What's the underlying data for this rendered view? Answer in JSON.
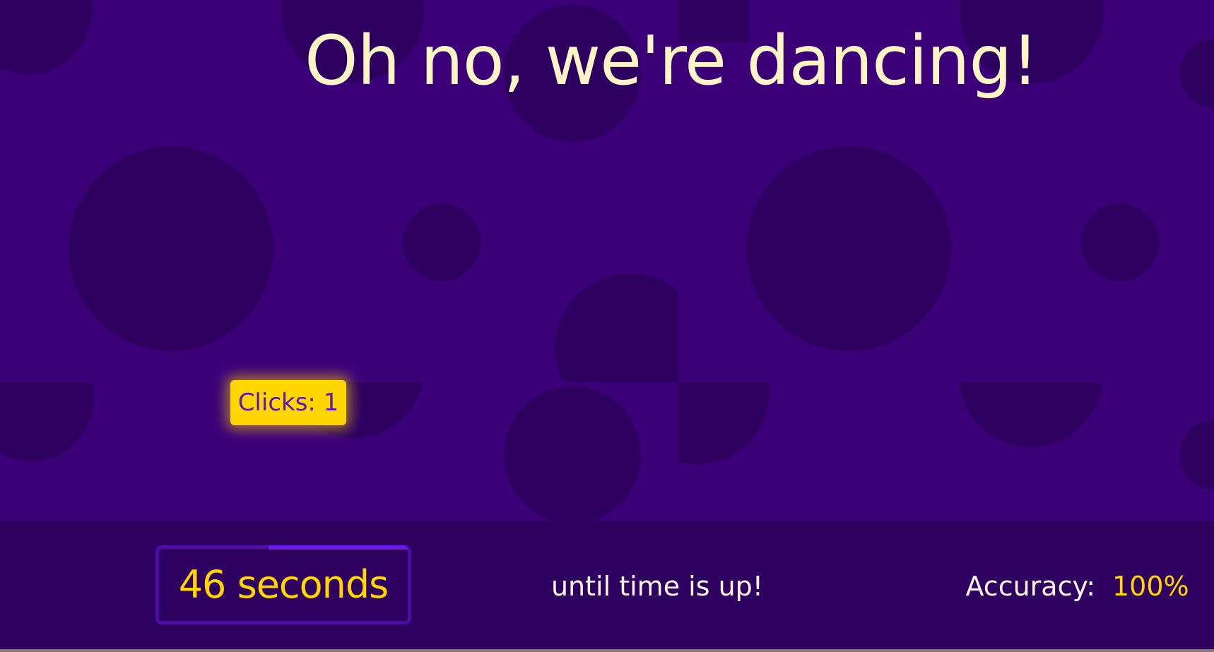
{
  "game": {
    "title": "Oh no, we're dancing!",
    "clicks_label": "Clicks: 1",
    "clicks": 1
  },
  "status_bar": {
    "timer_text": "46 seconds",
    "seconds_remaining": 46,
    "timer_progress_fraction": 0.55,
    "until_text": "until time is up!",
    "accuracy_label": "Accuracy:",
    "accuracy_value": "100%"
  },
  "colors": {
    "background": "#3b0078",
    "shape": "#2d0060",
    "footer": "#2e005f",
    "accent_yellow": "#ffd600",
    "title_cream": "#fff5c4",
    "timer_border": "#4d0ca6",
    "timer_progress": "#6a1ae6"
  }
}
